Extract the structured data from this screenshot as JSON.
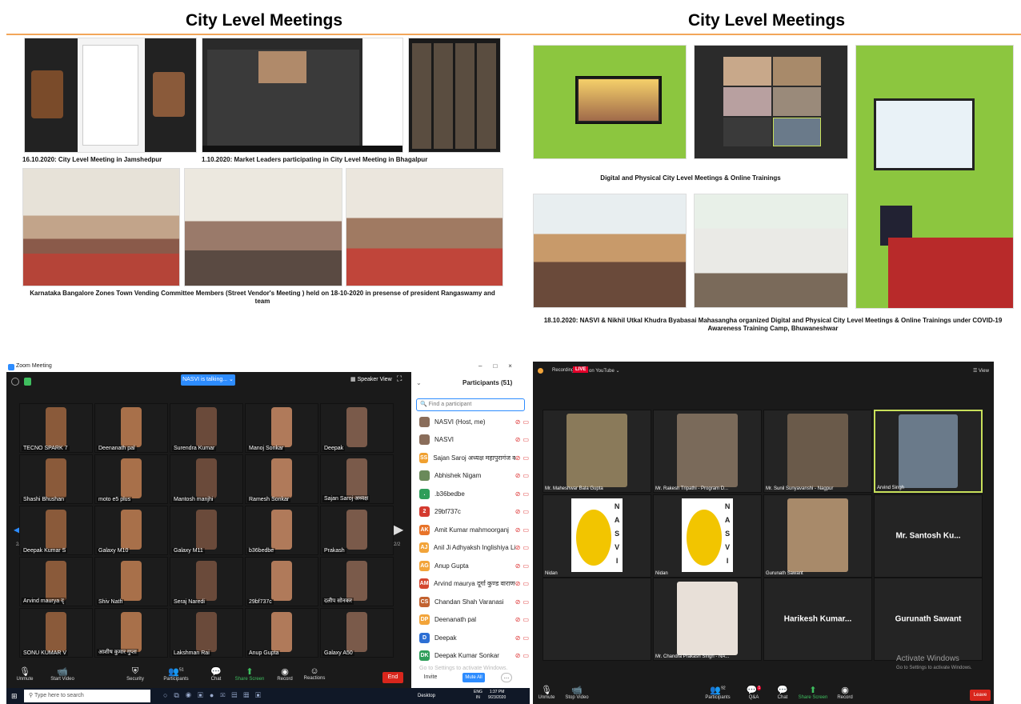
{
  "headers": {
    "left": "City Level Meetings",
    "right": "City Level Meetings"
  },
  "captions": {
    "jamshedpur": "16.10.2020: City Level Meeting in Jamshedpur",
    "bhagalpur": "1.10.2020: Market Leaders participating in City Level Meeting in Bhagalpur",
    "karnataka": "Karnataka  Bangalore  Zones  Town Vending  Committee Members (Street Vendor's Meeting ) held  on 18-10-2020 in presense of president Rangaswamy and team",
    "digital": "Digital and Physical City Level Meetings & Online Trainings",
    "bhuwaneshwar": "18.10.2020: NASVI & Nikhil Utkal Khudra Byabasai Mahasangha organized Digital and Physical City Level Meetings & Online Trainings under COVID-19 Awareness Training Camp, Bhuwaneshwar"
  },
  "zoom": {
    "window_title": "Zoom Meeting",
    "talking_label": "NASVI is talking...",
    "speaker_view": "Speaker View",
    "page_left": "2/2",
    "page_right": "2/2",
    "tiles": [
      "TECNO SPARK 7",
      "Deenanath pal",
      "Surendra Kumar",
      "Manoj Sonkar",
      "Deepak",
      "Shashi Bhushan",
      "moto e5 plus",
      "Mantosh manjhi",
      "Ramesh Sonkar",
      "Sajan Saroj अध्यक्ष",
      "Deepak Kumar S",
      "Galaxy M10",
      "Galaxy M11",
      "b36bedbe",
      "Prakash",
      "Arvind maurya द्",
      "Shiv Nath",
      "Seraj Naredi",
      "29bf737c",
      "दलीप सोनकर",
      "SONU KUMAR V",
      "आशीष कुमार गुप्ता",
      "Lakshman Rai",
      "Anup Gupta",
      "Galaxy A50"
    ],
    "participants_title": "Participants (51)",
    "search_placeholder": "Find a participant",
    "participants": [
      {
        "initials": "",
        "name": "NASVI (Host, me)",
        "color": "#8a6d5a"
      },
      {
        "initials": "",
        "name": "NASVI",
        "color": "#8a6d5a"
      },
      {
        "initials": "SS",
        "name": "Sajan Saroj  अध्यक्ष महापुरागंज वारा...",
        "color": "#f0a030"
      },
      {
        "initials": "",
        "name": "Abhishek Nigam",
        "color": "#6a8a5a"
      },
      {
        "initials": ".",
        "name": ".b36bedbe",
        "color": "#2f9e5a"
      },
      {
        "initials": "2",
        "name": "29bf737c",
        "color": "#d43a2f"
      },
      {
        "initials": "AK",
        "name": "Amit Kumar mahmoorganj",
        "color": "#e8742a"
      },
      {
        "initials": "AJ",
        "name": "Anil Ji Adhyaksh Inglishiya Line",
        "color": "#f2a43a"
      },
      {
        "initials": "AG",
        "name": "Anup Gupta",
        "color": "#f2a43a"
      },
      {
        "initials": "AM",
        "name": "Arvind maurya दूर्गा कुण्ड वाराणसी",
        "color": "#d4472f"
      },
      {
        "initials": "CS",
        "name": "Chandan Shah Varanasi",
        "color": "#c2622f"
      },
      {
        "initials": "DP",
        "name": "Deenanath pal",
        "color": "#f2a43a"
      },
      {
        "initials": "D",
        "name": "Deepak",
        "color": "#2d6fd4"
      },
      {
        "initials": "DK",
        "name": "Deepak Kumar Sonkar",
        "color": "#2f9e5a"
      }
    ],
    "activate_overlay": "Go to Settings to activate Windows.",
    "invite": "Invite",
    "mute_all": "Mute All",
    "toolbar": [
      "Unmute",
      "Start Video",
      "Security",
      "Participants",
      "Chat",
      "Share Screen",
      "Record",
      "Reactions"
    ],
    "participants_count": "51",
    "end": "End",
    "taskbar_search": "Type here to search",
    "desktop": "Desktop",
    "lang": "ENG",
    "lang2": "IN",
    "time": "1:37 PM",
    "date": "9/23/2020"
  },
  "gallery": {
    "recording": "Recording",
    "live": "LIVE",
    "youtube": "on YouTube",
    "view": "View",
    "tiles": [
      "Mr. Maheshwar Bala Gupta",
      "Mr. Rakesh Tripathi - Program D...",
      "Mr. Sunil Sunyavanshi - Nagpur",
      "Arvind Singh",
      "Nidan",
      "Nidan",
      "Gurunath Sawant",
      "",
      "",
      "",
      "",
      "",
      "Mr. Chandra Prakash Singh - NA...",
      ""
    ],
    "big_names": [
      "Mr. Santosh Ku...",
      "Gurunath Sawant",
      "Harikesh Kumar...",
      "Gurunath Sawant"
    ],
    "nasvi_letters": "NASVI",
    "activate_title": "Activate Windows",
    "activate_sub": "Go to Settings to activate Windows.",
    "toolbar": [
      "Unmute",
      "Stop Video",
      "Participants",
      "Q&A",
      "Chat",
      "Share Screen",
      "Record"
    ],
    "participants_count": "92",
    "qa_badge": "1",
    "leave": "Leave"
  }
}
